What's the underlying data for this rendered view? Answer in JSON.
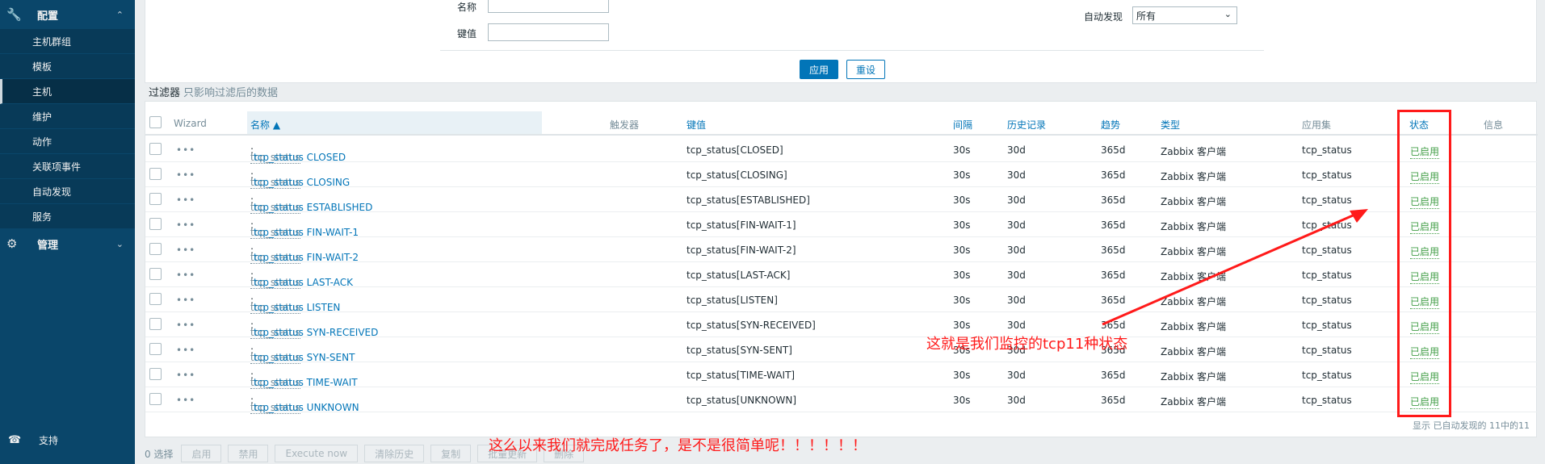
{
  "sidebar": {
    "config_label": "配置",
    "config_items": [
      "主机群组",
      "模板",
      "主机",
      "维护",
      "动作",
      "关联项事件",
      "自动发现",
      "服务"
    ],
    "active_index": 2,
    "manage_label": "管理",
    "support_label": "支持"
  },
  "filter": {
    "name_label": "名称",
    "key_label": "键值",
    "discovery_label": "自动发现",
    "discovery_value": "所有",
    "apply_label": "应用",
    "reset_label": "重设",
    "tab_label": "过滤器",
    "tab_hint": "只影响过滤后的数据"
  },
  "table": {
    "headers": {
      "wizard": "Wizard",
      "name": "名称 ▲",
      "triggers": "触发器",
      "key": "键值",
      "interval": "间隔",
      "history": "历史记录",
      "trends": "趋势",
      "type": "类型",
      "apps": "应用集",
      "status": "状态",
      "info": "信息"
    },
    "rows": [
      {
        "prefix": "tcp_status",
        "name": "tcp_status CLOSED",
        "key": "tcp_status[CLOSED]",
        "interval": "30s",
        "history": "30d",
        "trends": "365d",
        "type": "Zabbix 客户端",
        "app": "tcp_status",
        "status": "已启用"
      },
      {
        "prefix": "tcp_status",
        "name": "tcp_status CLOSING",
        "key": "tcp_status[CLOSING]",
        "interval": "30s",
        "history": "30d",
        "trends": "365d",
        "type": "Zabbix 客户端",
        "app": "tcp_status",
        "status": "已启用"
      },
      {
        "prefix": "tcp_status",
        "name": "tcp_status ESTABLISHED",
        "key": "tcp_status[ESTABLISHED]",
        "interval": "30s",
        "history": "30d",
        "trends": "365d",
        "type": "Zabbix 客户端",
        "app": "tcp_status",
        "status": "已启用"
      },
      {
        "prefix": "tcp_status",
        "name": "tcp_status FIN-WAIT-1",
        "key": "tcp_status[FIN-WAIT-1]",
        "interval": "30s",
        "history": "30d",
        "trends": "365d",
        "type": "Zabbix 客户端",
        "app": "tcp_status",
        "status": "已启用"
      },
      {
        "prefix": "tcp_status",
        "name": "tcp_status FIN-WAIT-2",
        "key": "tcp_status[FIN-WAIT-2]",
        "interval": "30s",
        "history": "30d",
        "trends": "365d",
        "type": "Zabbix 客户端",
        "app": "tcp_status",
        "status": "已启用"
      },
      {
        "prefix": "tcp_status",
        "name": "tcp_status LAST-ACK",
        "key": "tcp_status[LAST-ACK]",
        "interval": "30s",
        "history": "30d",
        "trends": "365d",
        "type": "Zabbix 客户端",
        "app": "tcp_status",
        "status": "已启用"
      },
      {
        "prefix": "tcp_status",
        "name": "tcp_status LISTEN",
        "key": "tcp_status[LISTEN]",
        "interval": "30s",
        "history": "30d",
        "trends": "365d",
        "type": "Zabbix 客户端",
        "app": "tcp_status",
        "status": "已启用"
      },
      {
        "prefix": "tcp_status",
        "name": "tcp_status SYN-RECEIVED",
        "key": "tcp_status[SYN-RECEIVED]",
        "interval": "30s",
        "history": "30d",
        "trends": "365d",
        "type": "Zabbix 客户端",
        "app": "tcp_status",
        "status": "已启用"
      },
      {
        "prefix": "tcp_status",
        "name": "tcp_status SYN-SENT",
        "key": "tcp_status[SYN-SENT]",
        "interval": "30s",
        "history": "30d",
        "trends": "365d",
        "type": "Zabbix 客户端",
        "app": "tcp_status",
        "status": "已启用"
      },
      {
        "prefix": "tcp_status",
        "name": "tcp_status TIME-WAIT",
        "key": "tcp_status[TIME-WAIT]",
        "interval": "30s",
        "history": "30d",
        "trends": "365d",
        "type": "Zabbix 客户端",
        "app": "tcp_status",
        "status": "已启用"
      },
      {
        "prefix": "tcp_status",
        "name": "tcp_status UNKNOWN",
        "key": "tcp_status[UNKNOWN]",
        "interval": "30s",
        "history": "30d",
        "trends": "365d",
        "type": "Zabbix 客户端",
        "app": "tcp_status",
        "status": "已启用"
      }
    ],
    "footer": "显示 已自动发现的 11中的11"
  },
  "actions": {
    "selected_count": "0 选择",
    "buttons": [
      "启用",
      "禁用",
      "Execute now",
      "清除历史",
      "复制",
      "批量更新",
      "删除"
    ]
  },
  "annotations": {
    "middle": "这就是我们监控的tcp11种状态",
    "bottom": "这么以来我们就完成任务了，是不是很简单呢！！！！！！"
  },
  "colors": {
    "sidebar": "#0a466a",
    "link": "#0275b8",
    "enabled": "#429e47",
    "annotation": "#ff1a1a"
  }
}
